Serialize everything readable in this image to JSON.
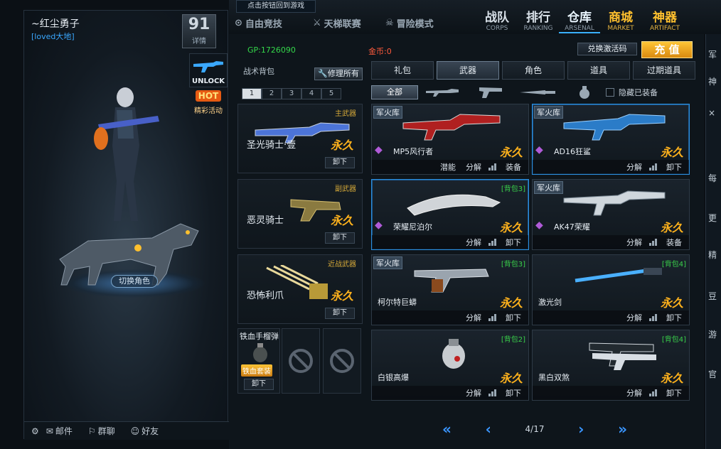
{
  "profile": {
    "username": "~红尘勇子",
    "guild": "[loved大地]",
    "level": "91",
    "level_label": "详情"
  },
  "side_actions": {
    "unlock_label": "UNLOCK",
    "hot_badge": "HOT",
    "event_label": "精彩活动",
    "switch_role": "切换角色"
  },
  "bottom_bar": {
    "mail": "邮件",
    "group_chat": "群聊",
    "friends": "好友"
  },
  "topnav": {
    "tip": "点击按钮回到游戏",
    "modes": [
      "自由竞技",
      "天梯联赛",
      "冒险模式"
    ],
    "main": [
      {
        "cn": "战队",
        "en": "CORPS"
      },
      {
        "cn": "排行",
        "en": "RANKING"
      },
      {
        "cn": "仓库",
        "en": "ARSENAL"
      },
      {
        "cn": "商城",
        "en": "MARKET"
      },
      {
        "cn": "神器",
        "en": "ARTIFACT"
      }
    ]
  },
  "currency": {
    "gp": "GP:1726090",
    "gold": "金币:0",
    "redeem": "兑换激活码",
    "recharge": "充 值"
  },
  "bag": {
    "title": "战术背包",
    "repair_all": "修理所有",
    "pages": [
      "1",
      "2",
      "3",
      "4",
      "5"
    ],
    "slots": [
      {
        "type": "主武器",
        "name": "圣光骑士·壹",
        "perm": "永久",
        "unequip": "卸下"
      },
      {
        "type": "副武器",
        "name": "恶灵骑士",
        "perm": "永久",
        "unequip": "卸下"
      },
      {
        "type": "近战武器",
        "name": "恐怖利爪",
        "perm": "永久",
        "unequip": "卸下"
      }
    ],
    "item_slot": {
      "name": "铁血手榴弹",
      "bag": "铁血套装",
      "unequip": "卸下"
    }
  },
  "tabs": [
    "礼包",
    "武器",
    "角色",
    "道具",
    "过期道具"
  ],
  "filter": {
    "all": "全部",
    "hide_equipped": "隐藏已装备"
  },
  "grid": [
    {
      "tag": "军火库",
      "bag": "",
      "name": "MP5风行者",
      "perm": "永久",
      "actions": [
        "潜能",
        "分解",
        "装备"
      ]
    },
    {
      "tag": "军火库",
      "bag": "",
      "name": "AD16狂鲨",
      "perm": "永久",
      "actions": [
        "分解",
        "卸下"
      ]
    },
    {
      "tag": "",
      "bag": "[背包3]",
      "name": "荣耀尼泊尔",
      "perm": "永久",
      "actions": [
        "分解",
        "卸下"
      ]
    },
    {
      "tag": "军火库",
      "bag": "",
      "name": "AK47荣耀",
      "perm": "永久",
      "actions": [
        "分解",
        "装备"
      ]
    },
    {
      "tag": "军火库",
      "bag": "[背包3]",
      "name": "柯尔特巨蟒",
      "perm": "永久",
      "actions": [
        "分解",
        "卸下"
      ]
    },
    {
      "tag": "",
      "bag": "[背包4]",
      "name": "激光剑",
      "perm": "永久",
      "actions": [
        "分解",
        "卸下"
      ]
    },
    {
      "tag": "",
      "bag": "[背包2]",
      "name": "白银高爆",
      "perm": "永久",
      "actions": [
        "分解",
        "卸下"
      ]
    },
    {
      "tag": "",
      "bag": "[背包4]",
      "name": "黑白双煞",
      "perm": "永久",
      "actions": [
        "分解",
        "卸下"
      ]
    }
  ],
  "pager": {
    "current": "4/17"
  },
  "right_strip": [
    "军",
    "神",
    "×",
    "每",
    "更",
    "精",
    "豆",
    "游",
    "官"
  ],
  "colors": {
    "accent": "#3ab0ff",
    "gold": "#ffb21c",
    "gp": "#34d84a",
    "perm": "#ffb21c"
  }
}
